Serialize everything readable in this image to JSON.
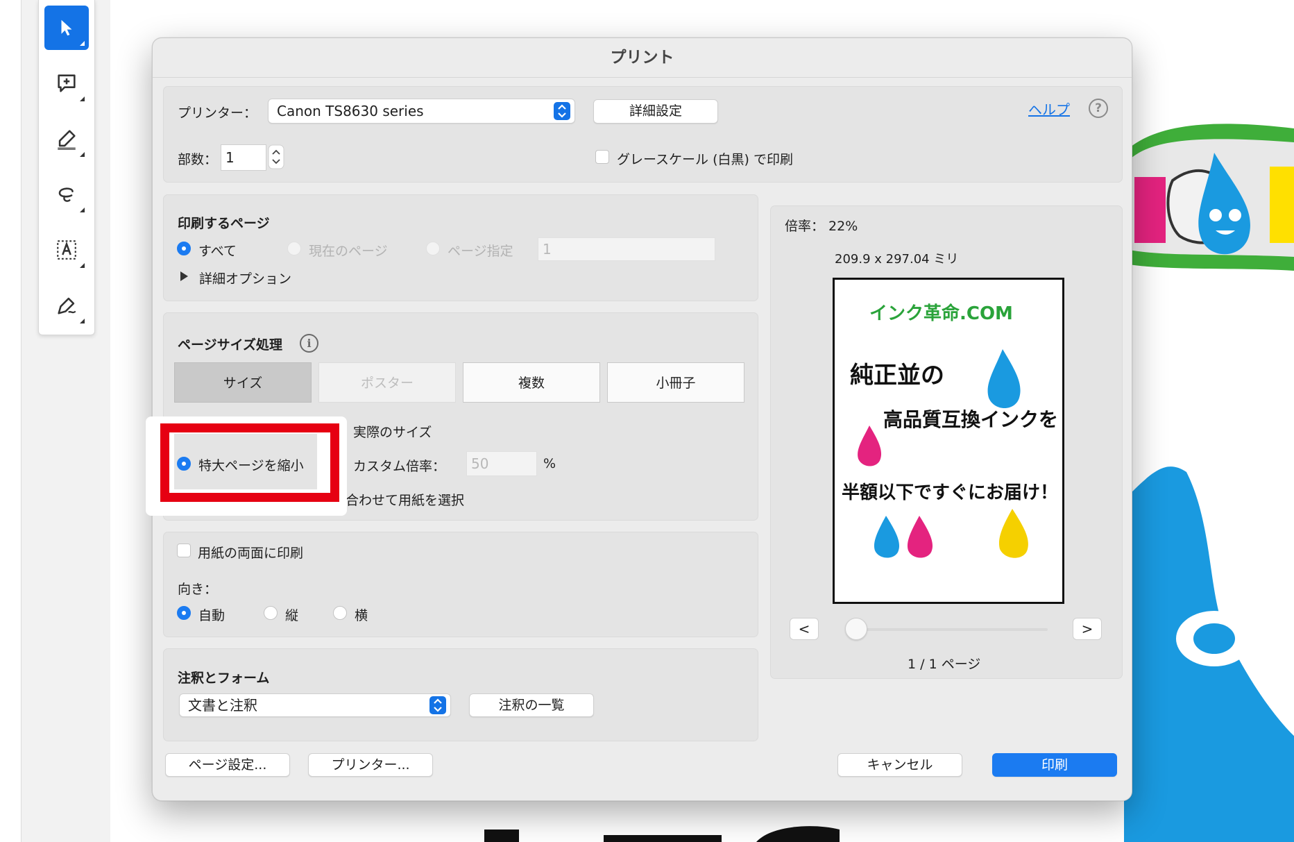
{
  "dialog": {
    "title": "プリント",
    "printer_label": "プリンター：",
    "printer_value": "Canon TS8630 series",
    "advanced_button": "詳細設定",
    "help_link": "ヘルプ",
    "help_icon": "?",
    "copies_label": "部数：",
    "copies_value": "1",
    "grayscale_label": "グレースケール (白黒) で印刷"
  },
  "pages": {
    "heading": "印刷するページ",
    "all": "すべて",
    "current": "現在のページ",
    "range": "ページ指定",
    "range_value": "1",
    "more_options": "詳細オプション"
  },
  "page_size": {
    "heading": "ページサイズ処理",
    "info_icon": "i",
    "tabs": [
      "サイズ",
      "ポスター",
      "複数",
      "小冊子"
    ],
    "actual_size": "実際のサイズ",
    "shrink": "特大ページを縮小",
    "custom_scale_label": "カスタム倍率：",
    "custom_scale_value": "50",
    "percent": "%",
    "choose_paper": "合わせて用紙を選択"
  },
  "duplex": {
    "label": "用紙の両面に印刷",
    "orientation_label": "向き：",
    "auto": "自動",
    "portrait": "縦",
    "landscape": "横"
  },
  "comments": {
    "heading": "注釈とフォーム",
    "value": "文書と注釈",
    "summarize_button": "注釈の一覧"
  },
  "preview": {
    "scale": "倍率： 22%",
    "dimensions": "209.9 x 297.04 ミリ",
    "prev": "<",
    "next": ">",
    "page_count": "1 / 1 ページ",
    "art_logo": "インク革命.COM",
    "art_line1": "純正並の",
    "art_line2": "高品質互換インクを",
    "art_line3": "半額以下ですぐにお届け！"
  },
  "footer": {
    "page_setup": "ページ設定...",
    "printer": "プリンター...",
    "cancel": "キャンセル",
    "print": "印刷"
  },
  "colors": {
    "accent": "#1b7bf1",
    "highlight_red": "#e60012",
    "tool_active": "#1473e6"
  }
}
